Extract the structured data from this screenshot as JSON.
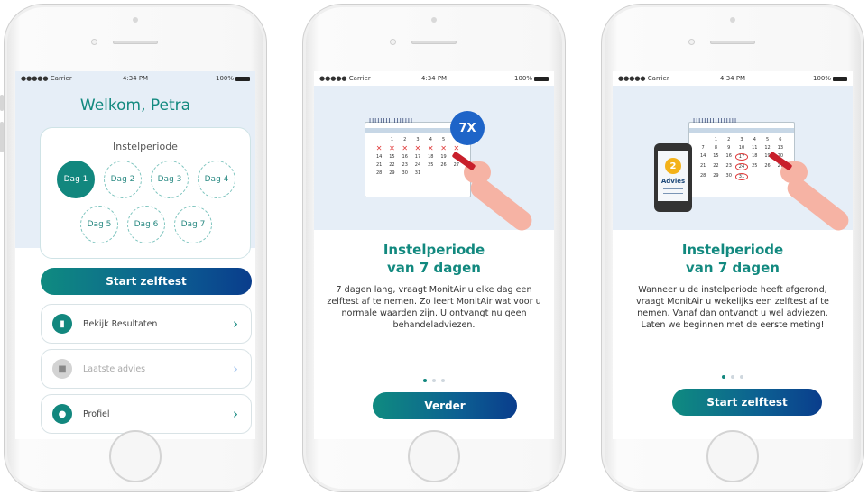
{
  "status_bar": {
    "carrier": "●●●●● Carrier",
    "time": "4:34 PM",
    "battery": "100%"
  },
  "screen1": {
    "welcome": "Welkom, Petra",
    "card_title": "Instelperiode",
    "days": [
      "Dag 1",
      "Dag 2",
      "Dag 3",
      "Dag 4",
      "Dag 5",
      "Dag 6",
      "Dag 7"
    ],
    "active_day": "Dag 1",
    "start_button": "Start zelftest",
    "menu": [
      {
        "label": "Bekijk Resultaten",
        "icon": "chart-icon",
        "enabled": true
      },
      {
        "label": "Laatste advies",
        "icon": "lock-icon",
        "enabled": false
      },
      {
        "label": "Profiel",
        "icon": "user-icon",
        "enabled": true
      }
    ]
  },
  "screen2": {
    "badge": "7X",
    "title_line1": "Instelperiode",
    "title_line2": "van 7 dagen",
    "body": "7 dagen lang, vraagt MonitAir u elke dag een zelftest af te nemen. Zo leert MonitAir wat voor u normale waarden zijn. U ontvangt nu geen behandeladviezen.",
    "button": "Verder",
    "page_index": 0,
    "page_count": 3
  },
  "screen3": {
    "phone_badge": "2",
    "phone_label": "Advies",
    "title_line1": "Instelperiode",
    "title_line2": "van 7 dagen",
    "body": "Wanneer u de instelperiode heeft afgerond, vraagt MonitAir u wekelijks een zelftest af te nemen. Vanaf dan ontvangt u wel adviezen. Laten we beginnen met de eerste meting!",
    "button": "Start zelftest",
    "page_index": 0,
    "page_count": 3
  },
  "calendar": {
    "dates": [
      "",
      "1",
      "2",
      "3",
      "4",
      "5",
      "6",
      "7",
      "8",
      "9",
      "10",
      "11",
      "12",
      "13",
      "14",
      "15",
      "16",
      "17",
      "18",
      "19",
      "20",
      "21",
      "22",
      "23",
      "24",
      "25",
      "26",
      "27",
      "28",
      "29",
      "30",
      "31",
      "",
      "",
      ""
    ],
    "crossed_screen2": [
      "7",
      "8",
      "9",
      "10",
      "11",
      "12",
      "13"
    ],
    "circled_screen3": [
      "17",
      "24",
      "31"
    ]
  },
  "colors": {
    "teal": "#12897f",
    "blue": "#0a3d8c",
    "badge_blue": "#1e64c8",
    "illus_bg": "#e6eef7"
  }
}
